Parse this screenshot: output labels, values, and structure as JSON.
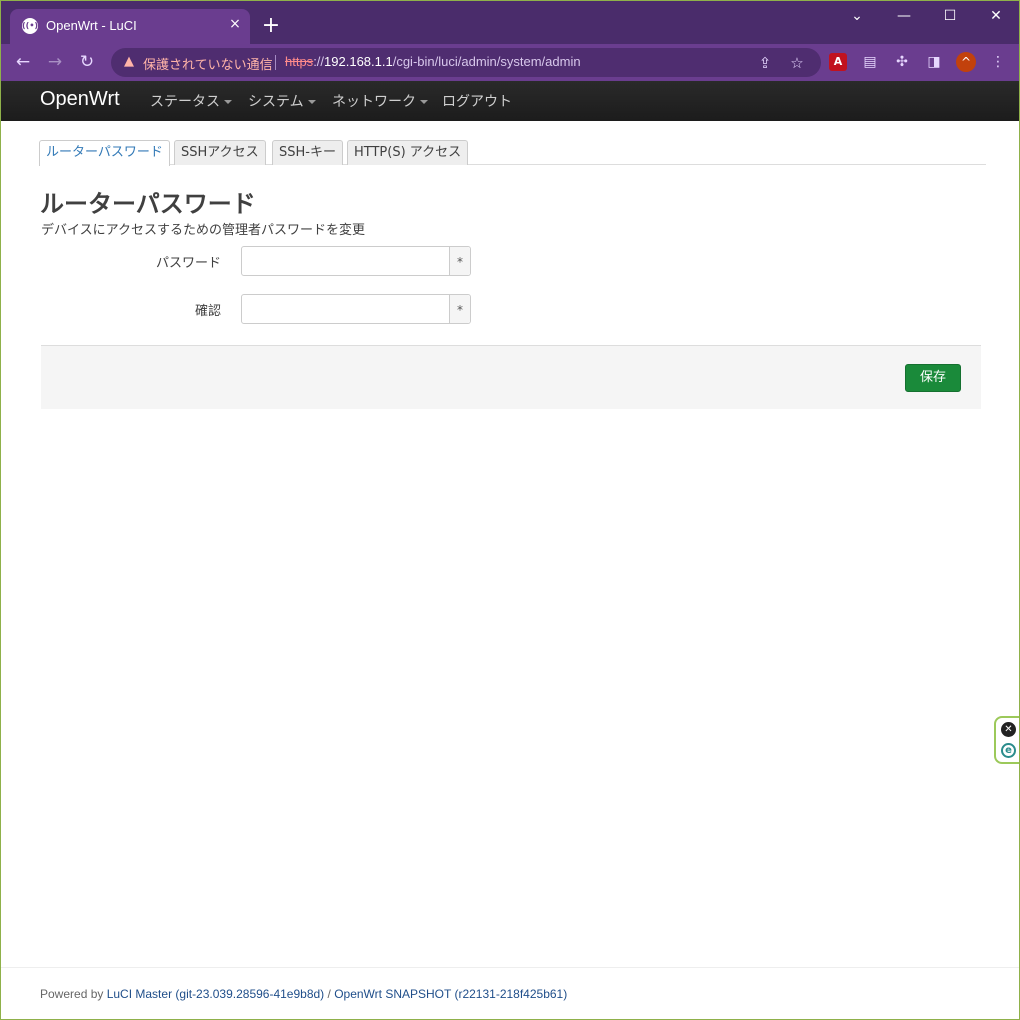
{
  "browser": {
    "tab_title": "OpenWrt - LuCI",
    "tab_close": "×",
    "new_tab": "+",
    "favicon_glyph": "((•))",
    "window_controls": {
      "collapse": "⌄",
      "minimize": "—",
      "maximize": "☐",
      "close": "✕"
    },
    "nav": {
      "back": "←",
      "forward": "→",
      "reload": "↻"
    },
    "security_warning_icon": "▲",
    "security_warning": "保護されていない通信",
    "url": {
      "scheme": "https",
      "separator": "://",
      "host": "192.168.1.1",
      "path": "/cgi-bin/luci/admin/system/admin"
    },
    "omnibox_icons": {
      "share": "⇪",
      "bookmark": "☆"
    },
    "extensions": {
      "pdf": "A",
      "reader": "▤",
      "puzzle": "✣",
      "sidepanel": "◨",
      "profile": "^",
      "menu": "⋮"
    }
  },
  "luci": {
    "brand": "OpenWrt",
    "menu": [
      {
        "label": "ステータス",
        "dropdown": true
      },
      {
        "label": "システム",
        "dropdown": true
      },
      {
        "label": "ネットワーク",
        "dropdown": true
      },
      {
        "label": "ログアウト",
        "dropdown": false
      }
    ]
  },
  "page": {
    "tabs": [
      "ルーターパスワード",
      "SSHアクセス",
      "SSH-キー",
      "HTTP(S) アクセス"
    ],
    "active_tab": 0,
    "title": "ルーターパスワード",
    "description": "デバイスにアクセスするための管理者パスワードを変更",
    "fields": [
      {
        "label": "パスワード",
        "value": "",
        "reveal": "*"
      },
      {
        "label": "確認",
        "value": "",
        "reveal": "*"
      }
    ],
    "save_label": "保存"
  },
  "side_widget": {
    "close": "✕",
    "extension": "e"
  },
  "footer": {
    "powered_by": "Powered by ",
    "luci_link": "LuCI Master (git-23.039.28596-41e9b8d)",
    "separator": " / ",
    "openwrt_link": "OpenWrt SNAPSHOT (r22131-218f425b61)"
  },
  "colors": {
    "browser_frame": "#4a2c6b",
    "browser_toolbar": "#6a3d8f",
    "luci_header": "#222222",
    "active_tab_text": "#337ab7",
    "save_button": "#1a8a3a",
    "link": "#1f4e8a"
  }
}
